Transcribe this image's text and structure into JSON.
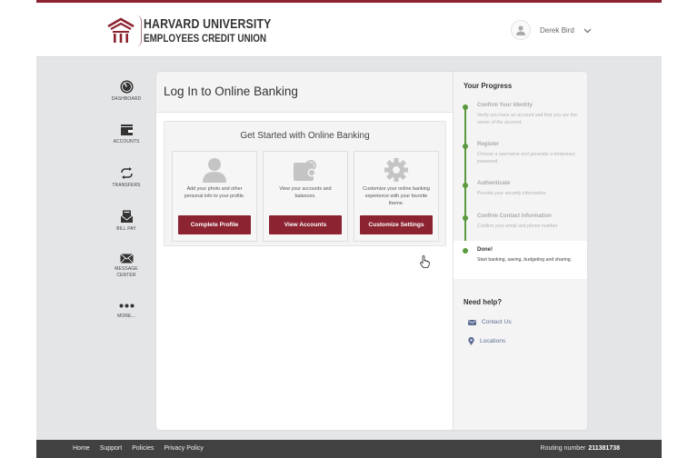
{
  "brand": {
    "line1": "HARVARD UNIVERSITY",
    "line2": "EMPLOYEES CREDIT UNION",
    "accent_color": "#8c2330"
  },
  "user": {
    "name": "Derek Bird",
    "avatar_icon": "user-icon",
    "menu_icon": "chevron-down-icon"
  },
  "sidenav": {
    "items": [
      {
        "label": "DASHBOARD",
        "icon": "gauge-icon"
      },
      {
        "label": "ACCOUNTS",
        "icon": "wallet-icon"
      },
      {
        "label": "TRANSFERS",
        "icon": "transfer-arrows-icon"
      },
      {
        "label": "BILL PAY",
        "icon": "bill-envelope-icon"
      },
      {
        "label": "MESSAGE",
        "label2": "CENTER",
        "icon": "envelope-icon"
      },
      {
        "label": "MORE...",
        "icon": "more-dots-icon"
      }
    ]
  },
  "main": {
    "title": "Log In to Online Banking",
    "get_started": {
      "title": "Get Started with Online Banking",
      "tiles": [
        {
          "icon": "person-icon",
          "text": "Add your photo and other personal info to your profile.",
          "button": "Complete Profile"
        },
        {
          "icon": "wallet-icon",
          "text": "View your accounts and balances.",
          "button": "View Accounts"
        },
        {
          "icon": "gear-icon",
          "text": "Customize your online banking experience with your favorite theme.",
          "button": "Customize Settings"
        }
      ]
    }
  },
  "progress": {
    "title": "Your Progress",
    "color": "#5a9a3e",
    "steps": [
      {
        "title": "Confirm Your Identity",
        "desc": "Verify you have an account and that you are the owner of the account.",
        "state": "complete"
      },
      {
        "title": "Register",
        "desc": "Choose a username and generate a temporary password.",
        "state": "complete"
      },
      {
        "title": "Authenticate",
        "desc": "Provide your security information",
        "state": "complete"
      },
      {
        "title": "Confirm Contact Information",
        "desc": "Confirm your email and phone number",
        "state": "complete"
      },
      {
        "title": "Done!",
        "desc": "Start banking, saving, budgeting and sharing.",
        "state": "current"
      }
    ]
  },
  "help": {
    "title": "Need help?",
    "links": [
      {
        "label": "Contact Us",
        "icon": "mail-icon"
      },
      {
        "label": "Locations",
        "icon": "map-pin-icon"
      }
    ]
  },
  "footer": {
    "links": [
      "Home",
      "Support",
      "Policies",
      "Privacy Policy"
    ],
    "routing_label": "Routing number",
    "routing_number": "211381738"
  }
}
